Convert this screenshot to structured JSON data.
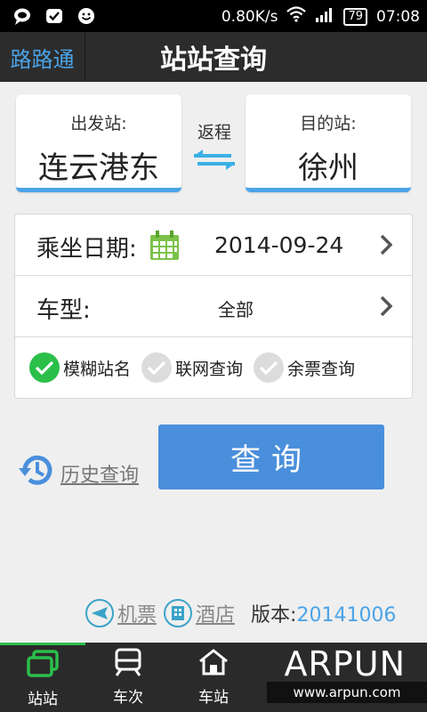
{
  "status_bar": {
    "speed": "0.80K/s",
    "battery": "79",
    "time": "07:08"
  },
  "header": {
    "app_name": "路路通",
    "title": "站站查询"
  },
  "from_station": {
    "label": "出发站:",
    "value": "连云港东"
  },
  "to_station": {
    "label": "目的站:",
    "value": "徐州"
  },
  "swap": {
    "label": "返程"
  },
  "form": {
    "date_label": "乘坐日期:",
    "date_value": "2014-09-24",
    "type_label": "车型:",
    "type_value": "全部",
    "options": [
      {
        "label": "模糊站名",
        "checked": true
      },
      {
        "label": "联网查询",
        "checked": false
      },
      {
        "label": "余票查询",
        "checked": false
      }
    ]
  },
  "history_label": "历史查询",
  "search_button": "查询",
  "links": {
    "flights": "机票",
    "hotels": "酒店",
    "version_label": "版本:",
    "version_value": "20141006"
  },
  "nav": [
    {
      "label": "站站",
      "active": true
    },
    {
      "label": "车次",
      "active": false
    },
    {
      "label": "车站",
      "active": false
    }
  ],
  "watermark": {
    "brand": "ARPUN",
    "url": "www.arpun.com"
  },
  "colors": {
    "accent": "#4aa3e8",
    "button": "#4a8fdc",
    "check_on": "#2bbf4a",
    "header": "#2c2c2c"
  }
}
